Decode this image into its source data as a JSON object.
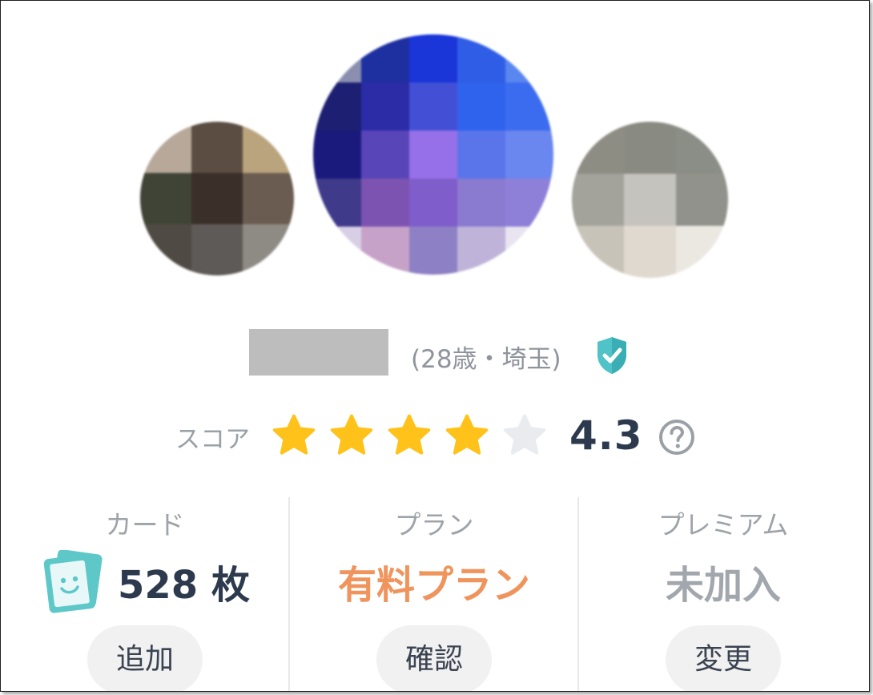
{
  "profile": {
    "age_area": "(28歳・埼玉)",
    "verified_icon": "shield-check-icon",
    "colors": {
      "verified": "#4fc3c8"
    }
  },
  "score": {
    "label": "スコア",
    "value": "4.3",
    "stars_filled": 4,
    "stars_total": 5,
    "help_icon": "question-circle-icon",
    "colors": {
      "star_on": "#ffc21a",
      "star_off": "#e9ebee"
    }
  },
  "stats": {
    "card": {
      "title": "カード",
      "value": "528 枚",
      "button": "追加",
      "icon": "card-smile-icon"
    },
    "plan": {
      "title": "プラン",
      "value": "有料プラン",
      "button": "確認"
    },
    "premium": {
      "title": "プレミアム",
      "value": "未加入",
      "button": "変更"
    },
    "colors": {
      "plan": "#f0945d",
      "premium": "#a2a7ae",
      "card_icon": "#5ec8c9"
    }
  }
}
